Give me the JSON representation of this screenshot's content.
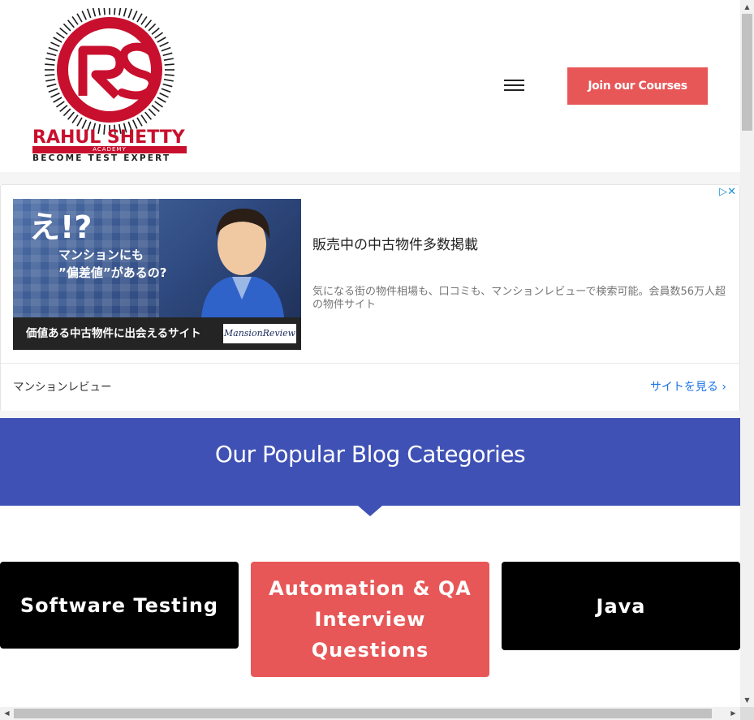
{
  "header": {
    "logo_main": "RAHUL SHETTY",
    "logo_academy": "ACADEMY",
    "logo_tagline": "BECOME TEST EXPERT",
    "menu_icon": "hamburger-icon",
    "join_button_label": "Join our Courses",
    "brand_color": "#c8102e",
    "accent_color": "#e85757"
  },
  "ad": {
    "image_big_text": "え!?",
    "image_sub_line1": "マンションにも",
    "image_sub_line2": "”偏差値”があるの?",
    "image_bottom_text": "価値ある中古物件に出会えるサイト",
    "image_brand_badge": "MansionReview",
    "headline": "販売中の中古物件多数掲載",
    "description": "気になる街の物件相場も、口コミも、マンションレビューで検索可能。会員数56万人超の物件サイト",
    "advertiser": "マンションレビュー",
    "cta": "サイトを見る ›",
    "choices_icons": "▷✕"
  },
  "categories": {
    "banner_title": "Our Popular Blog Categories",
    "banner_color": "#3f51b5",
    "items": [
      {
        "label": "Software Testing",
        "color": "#000000"
      },
      {
        "label": "Automation & QA Interview Questions",
        "color": "#e85757"
      },
      {
        "label": "Java",
        "color": "#000000"
      }
    ]
  },
  "scrollbars": {
    "up_arrow": "▲",
    "down_arrow": "▼",
    "left_arrow": "◀",
    "right_arrow": "▶"
  }
}
